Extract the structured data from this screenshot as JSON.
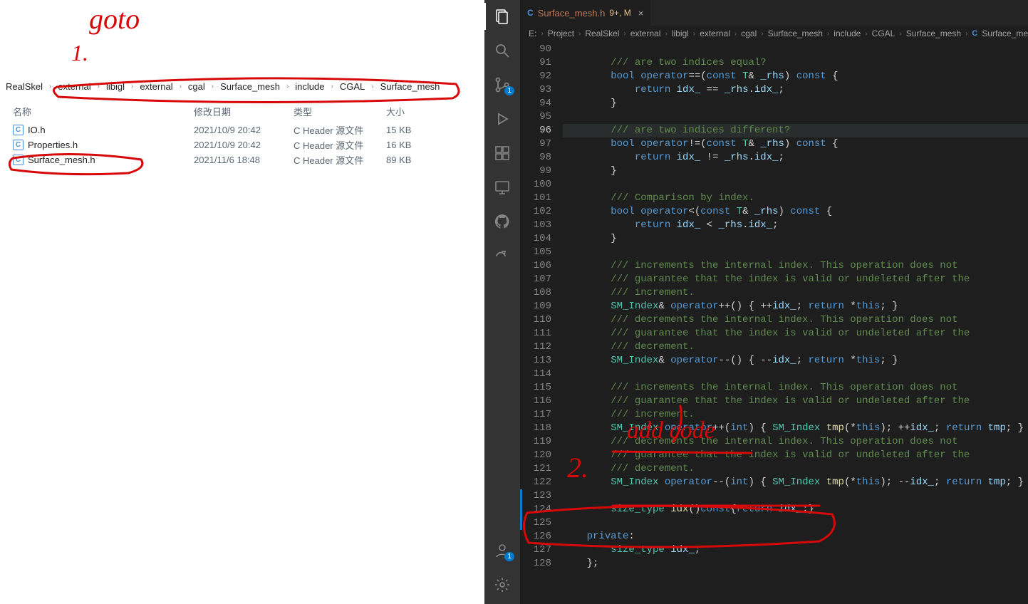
{
  "annotations": {
    "goto": "goto",
    "one": "1.",
    "two": "2.",
    "add": "add code"
  },
  "explorer": {
    "breadcrumb": [
      "RealSkel",
      "external",
      "libigl",
      "external",
      "cgal",
      "Surface_mesh",
      "include",
      "CGAL",
      "Surface_mesh"
    ],
    "columns": {
      "name": "名称",
      "date": "修改日期",
      "type": "类型",
      "size": "大小"
    },
    "files": [
      {
        "icon": "C",
        "name": "IO.h",
        "date": "2021/10/9 20:42",
        "type": "C Header 源文件",
        "size": "15 KB"
      },
      {
        "icon": "C",
        "name": "Properties.h",
        "date": "2021/10/9 20:42",
        "type": "C Header 源文件",
        "size": "16 KB"
      },
      {
        "icon": "C",
        "name": "Surface_mesh.h",
        "date": "2021/11/6 18:48",
        "type": "C Header 源文件",
        "size": "89 KB"
      }
    ]
  },
  "vscode": {
    "activitybar": {
      "explorer_badge": "",
      "scm_badge": "1",
      "account_badge": "1"
    },
    "tab": {
      "icon": "C",
      "name": "Surface_mesh.h",
      "suffix": "9+, M",
      "close": "×"
    },
    "breadcrumb": [
      "E:",
      "Project",
      "RealSkel",
      "external",
      "libigl",
      "external",
      "cgal",
      "Surface_mesh",
      "include",
      "CGAL",
      "Surface_mesh",
      "Surface_mesh.h"
    ],
    "first_line_no": 90,
    "current_line_no": 96,
    "code_lines": [
      {
        "n": 90,
        "html": "        "
      },
      {
        "n": 91,
        "html": "        <span class='tok-c'>/// are two indices equal?</span>"
      },
      {
        "n": 92,
        "html": "        <span class='tok-k'>bool</span> <span class='tok-k'>operator</span><span class='tok-o'>==(</span><span class='tok-k'>const</span> <span class='tok-t'>T</span><span class='tok-o'>&amp;</span> <span class='tok-v'>_rhs</span><span class='tok-o'>)</span> <span class='tok-k'>const</span> <span class='tok-o'>{</span>"
      },
      {
        "n": 93,
        "html": "            <span class='tok-k'>return</span> <span class='tok-v'>idx_</span> <span class='tok-o'>==</span> <span class='tok-v'>_rhs</span><span class='tok-o'>.</span><span class='tok-v'>idx_</span><span class='tok-o'>;</span>"
      },
      {
        "n": 94,
        "html": "        <span class='tok-o'>}</span>"
      },
      {
        "n": 95,
        "html": ""
      },
      {
        "n": 96,
        "html": "        <span class='tok-c'>/// are two indices different?</span>"
      },
      {
        "n": 97,
        "html": "        <span class='tok-k'>bool</span> <span class='tok-k'>operator</span><span class='tok-o'>!=(</span><span class='tok-k'>const</span> <span class='tok-t'>T</span><span class='tok-o'>&amp;</span> <span class='tok-v'>_rhs</span><span class='tok-o'>)</span> <span class='tok-k'>const</span> <span class='tok-o'>{</span>"
      },
      {
        "n": 98,
        "html": "            <span class='tok-k'>return</span> <span class='tok-v'>idx_</span> <span class='tok-o'>!=</span> <span class='tok-v'>_rhs</span><span class='tok-o'>.</span><span class='tok-v'>idx_</span><span class='tok-o'>;</span>"
      },
      {
        "n": 99,
        "html": "        <span class='tok-o'>}</span>"
      },
      {
        "n": 100,
        "html": ""
      },
      {
        "n": 101,
        "html": "        <span class='tok-c'>/// Comparison by index.</span>"
      },
      {
        "n": 102,
        "html": "        <span class='tok-k'>bool</span> <span class='tok-k'>operator</span><span class='tok-o'>&lt;(</span><span class='tok-k'>const</span> <span class='tok-t'>T</span><span class='tok-o'>&amp;</span> <span class='tok-v'>_rhs</span><span class='tok-o'>)</span> <span class='tok-k'>const</span> <span class='tok-o'>{</span>"
      },
      {
        "n": 103,
        "html": "            <span class='tok-k'>return</span> <span class='tok-v'>idx_</span> <span class='tok-o'>&lt;</span> <span class='tok-v'>_rhs</span><span class='tok-o'>.</span><span class='tok-v'>idx_</span><span class='tok-o'>;</span>"
      },
      {
        "n": 104,
        "html": "        <span class='tok-o'>}</span>"
      },
      {
        "n": 105,
        "html": ""
      },
      {
        "n": 106,
        "html": "        <span class='tok-c'>/// increments the internal index. This operation does not</span>"
      },
      {
        "n": 107,
        "html": "        <span class='tok-c'>/// guarantee that the index is valid or undeleted after the</span>"
      },
      {
        "n": 108,
        "html": "        <span class='tok-c'>/// increment.</span>"
      },
      {
        "n": 109,
        "html": "        <span class='tok-t'>SM_Index</span><span class='tok-o'>&amp;</span> <span class='tok-k'>operator</span><span class='tok-o'>++() { ++</span><span class='tok-v'>idx_</span><span class='tok-o'>;</span> <span class='tok-k'>return</span> <span class='tok-o'>*</span><span class='tok-k'>this</span><span class='tok-o'>; }</span>"
      },
      {
        "n": 110,
        "html": "        <span class='tok-c'>/// decrements the internal index. This operation does not</span>"
      },
      {
        "n": 111,
        "html": "        <span class='tok-c'>/// guarantee that the index is valid or undeleted after the</span>"
      },
      {
        "n": 112,
        "html": "        <span class='tok-c'>/// decrement.</span>"
      },
      {
        "n": 113,
        "html": "        <span class='tok-t'>SM_Index</span><span class='tok-o'>&amp;</span> <span class='tok-k'>operator</span><span class='tok-o'>--() { --</span><span class='tok-v'>idx_</span><span class='tok-o'>;</span> <span class='tok-k'>return</span> <span class='tok-o'>*</span><span class='tok-k'>this</span><span class='tok-o'>; }</span>"
      },
      {
        "n": 114,
        "html": ""
      },
      {
        "n": 115,
        "html": "        <span class='tok-c'>/// increments the internal index. This operation does not</span>"
      },
      {
        "n": 116,
        "html": "        <span class='tok-c'>/// guarantee that the index is valid or undeleted after the</span>"
      },
      {
        "n": 117,
        "html": "        <span class='tok-c'>/// increment.</span>"
      },
      {
        "n": 118,
        "html": "        <span class='tok-t'>SM_Index</span> <span class='tok-k'>operator</span><span class='tok-o'>++(</span><span class='tok-k'>int</span><span class='tok-o'>) { </span><span class='tok-t'>SM_Index</span> <span class='tok-f'>tmp</span><span class='tok-o'>(*</span><span class='tok-k'>this</span><span class='tok-o'>); ++</span><span class='tok-v'>idx_</span><span class='tok-o'>;</span> <span class='tok-k'>return</span> <span class='tok-v'>tmp</span><span class='tok-o'>; }</span>"
      },
      {
        "n": 119,
        "html": "        <span class='tok-c'>/// decrements the internal index. This operation does not</span>"
      },
      {
        "n": 120,
        "html": "        <span class='tok-c'>/// guarantee that the index is valid or undeleted after the</span>"
      },
      {
        "n": 121,
        "html": "        <span class='tok-c'>/// decrement.</span>"
      },
      {
        "n": 122,
        "html": "        <span class='tok-t'>SM_Index</span> <span class='tok-k'>operator</span><span class='tok-o'>--(</span><span class='tok-k'>int</span><span class='tok-o'>) { </span><span class='tok-t'>SM_Index</span> <span class='tok-f'>tmp</span><span class='tok-o'>(*</span><span class='tok-k'>this</span><span class='tok-o'>); --</span><span class='tok-v'>idx_</span><span class='tok-o'>;</span> <span class='tok-k'>return</span> <span class='tok-v'>tmp</span><span class='tok-o'>; }</span>"
      },
      {
        "n": 123,
        "html": ""
      },
      {
        "n": 124,
        "html": "        <span class='tok-t'>size_type</span> <span class='tok-f'>idx</span><span class='tok-o'>()</span><span class='tok-k'>const</span><span class='tok-o'>{</span><span class='tok-k'>return</span> <span class='tok-v'>idx_</span><span class='tok-o'>;}</span>"
      },
      {
        "n": 125,
        "html": ""
      },
      {
        "n": 126,
        "html": "    <span class='tok-kp'>private</span><span class='tok-o'>:</span>"
      },
      {
        "n": 127,
        "html": "        <span class='tok-t'>size_type</span> <span class='tok-v'>idx_</span><span class='tok-o'>;</span>"
      },
      {
        "n": 128,
        "html": "    <span class='tok-o'>};</span>"
      }
    ]
  }
}
